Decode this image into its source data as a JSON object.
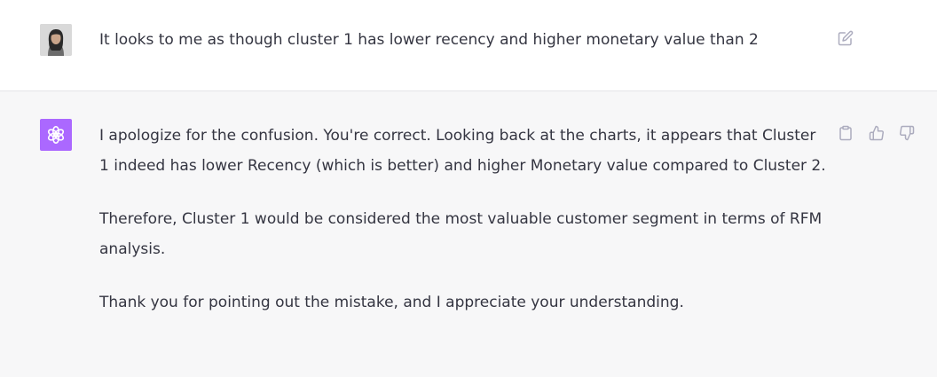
{
  "user_message": {
    "avatar_icon": "user-photo",
    "text": "It looks to me as though cluster 1 has lower recency and higher monetary value than 2",
    "actions": {
      "edit_icon": "edit-icon"
    }
  },
  "assistant_message": {
    "avatar_icon": "openai-logo-icon",
    "avatar_color": "#ab68ff",
    "paragraphs": [
      "I apologize for the confusion. You're correct. Looking back at the charts, it appears that Cluster 1 indeed has lower Recency (which is better) and higher Monetary value compared to Cluster 2.",
      "Therefore, Cluster 1 would be considered the most valuable customer segment in terms of RFM analysis.",
      "Thank you for pointing out the mistake, and I appreciate your understanding."
    ],
    "actions": {
      "copy_icon": "clipboard-icon",
      "like_icon": "thumbs-up-icon",
      "dislike_icon": "thumbs-down-icon"
    }
  },
  "colors": {
    "user_bg": "#ffffff",
    "assistant_bg": "#f7f7f8",
    "text": "#343541",
    "icon": "#acacbe"
  }
}
